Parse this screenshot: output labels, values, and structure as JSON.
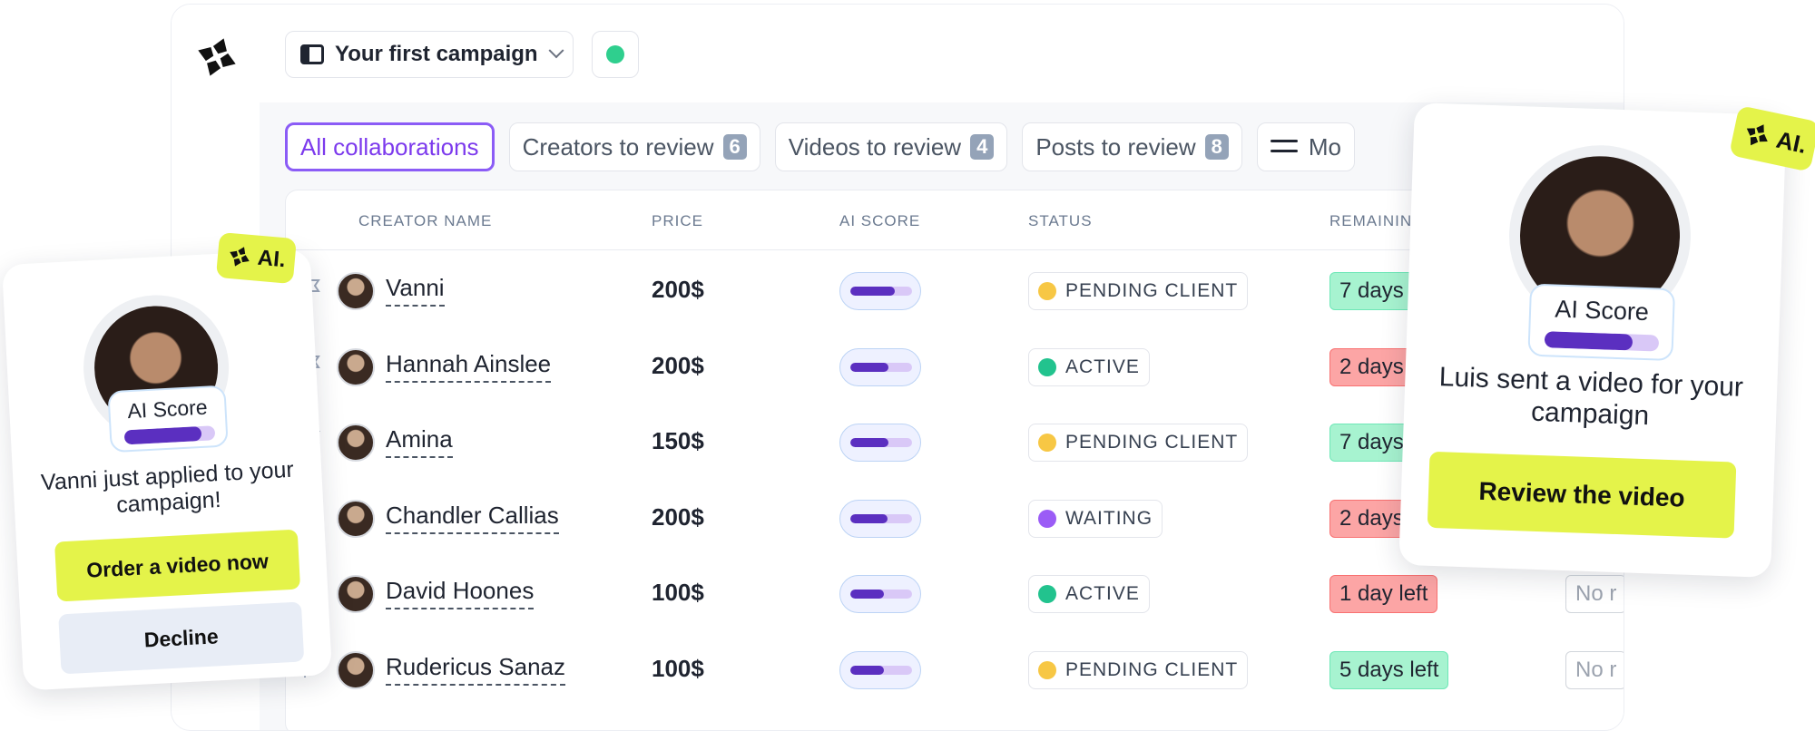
{
  "header": {
    "campaign_title": "Your first campaign",
    "status_color": "#2fcf8e"
  },
  "tabs": [
    {
      "label": "All collaborations",
      "count": null,
      "active": true
    },
    {
      "label": "Creators to review",
      "count": "6"
    },
    {
      "label": "Videos to review",
      "count": "4"
    },
    {
      "label": "Posts to review",
      "count": "8"
    },
    {
      "label": "Mo"
    }
  ],
  "table": {
    "headers": {
      "creator": "CREATOR NAME",
      "price": "PRICE",
      "ai_score": "AI SCORE",
      "status": "STATUS",
      "remaining": "REMAINING"
    },
    "rows": [
      {
        "name": "Vanni",
        "price": "200$",
        "ai_score": 0.72,
        "status": "PENDING CLIENT",
        "status_color": "#f7c744",
        "remaining": "7 days",
        "remaining_kind": "green"
      },
      {
        "name": "Hannah Ainslee",
        "price": "200$",
        "ai_score": 0.62,
        "status": "ACTIVE",
        "status_color": "#22c38e",
        "remaining": "2 days",
        "remaining_kind": "red"
      },
      {
        "name": "Amina",
        "price": "150$",
        "ai_score": 0.62,
        "status": "PENDING CLIENT",
        "status_color": "#f7c744",
        "remaining": "7 days",
        "remaining_kind": "green"
      },
      {
        "name": "Chandler Callias",
        "price": "200$",
        "ai_score": 0.6,
        "status": "WAITING",
        "status_color": "#9b5cf6",
        "remaining": "2 days",
        "remaining_kind": "red"
      },
      {
        "name": "David Hoones",
        "price": "100$",
        "ai_score": 0.55,
        "status": "ACTIVE",
        "status_color": "#22c38e",
        "remaining": "1 day left",
        "remaining_kind": "red",
        "extra": "No r"
      },
      {
        "name": "Rudericus Sanaz",
        "price": "100$",
        "ai_score": 0.55,
        "status": "PENDING CLIENT",
        "status_color": "#f7c744",
        "remaining": "5 days left",
        "remaining_kind": "green",
        "extra": "No r"
      }
    ]
  },
  "card_left": {
    "badge": "AI.",
    "score_label": "AI Score",
    "score": 0.85,
    "message_name": "Vanni",
    "message_rest": " just applied to your campaign!",
    "primary_button": "Order a video now",
    "secondary_button": "Decline"
  },
  "card_right": {
    "badge": "AI.",
    "score_label": "AI Score",
    "score": 0.77,
    "message_name": "Luis",
    "message_rest": " sent a video for your campaign",
    "primary_button": "Review the video"
  }
}
